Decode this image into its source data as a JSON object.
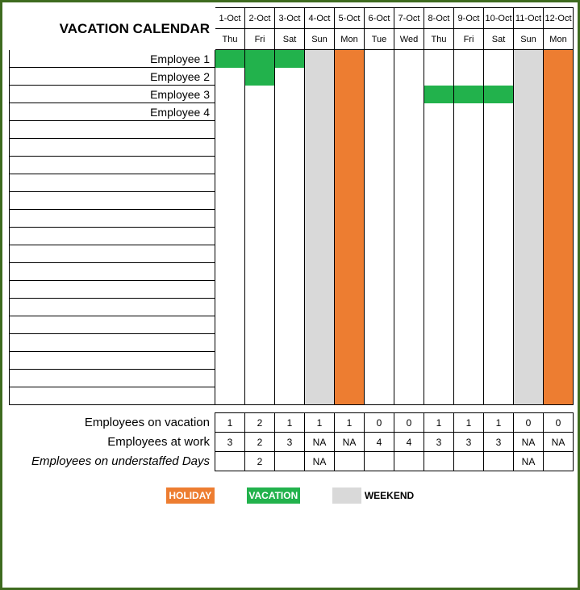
{
  "title": "VACATION CALENDAR",
  "dates": [
    "1-Oct",
    "2-Oct",
    "3-Oct",
    "4-Oct",
    "5-Oct",
    "6-Oct",
    "7-Oct",
    "8-Oct",
    "9-Oct",
    "10-Oct",
    "11-Oct",
    "12-Oct"
  ],
  "days": [
    "Thu",
    "Fri",
    "Sat",
    "Sun",
    "Mon",
    "Tue",
    "Wed",
    "Thu",
    "Fri",
    "Sat",
    "Sun",
    "Mon"
  ],
  "day_type": [
    "",
    "",
    "",
    "weekend",
    "holiday",
    "",
    "",
    "",
    "",
    "",
    "weekend",
    "holiday"
  ],
  "employees": [
    "Employee 1",
    "Employee 2",
    "Employee 3",
    "Employee 4",
    "",
    "",
    "",
    "",
    "",
    "",
    "",
    "",
    "",
    "",
    "",
    "",
    "",
    "",
    "",
    ""
  ],
  "vacations": {
    "0": [
      0,
      1,
      2
    ],
    "1": [
      1
    ],
    "2": [
      7,
      8,
      9
    ]
  },
  "summary": {
    "on_vacation": {
      "label": "Employees on vacation",
      "values": [
        "1",
        "2",
        "1",
        "1",
        "1",
        "0",
        "0",
        "1",
        "1",
        "1",
        "0",
        "0"
      ]
    },
    "at_work": {
      "label": "Employees at work",
      "values": [
        "3",
        "2",
        "3",
        "NA",
        "NA",
        "4",
        "4",
        "3",
        "3",
        "3",
        "NA",
        "NA"
      ]
    },
    "understaffed": {
      "label": "Employees on understaffed Days",
      "values": [
        "",
        "2",
        "",
        "NA",
        "",
        "",
        "",
        "",
        "",
        "",
        "NA",
        ""
      ]
    }
  },
  "legend": {
    "holiday": "HOLIDAY",
    "vacation": "VACATION",
    "weekend": "WEEKEND"
  }
}
